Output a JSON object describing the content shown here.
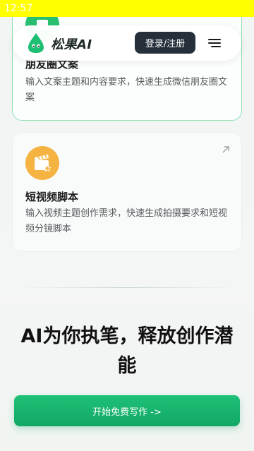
{
  "status_bar": {
    "time": "12:57"
  },
  "header": {
    "brand": "松果AI",
    "login_label": "登录/注册"
  },
  "cards": [
    {
      "title": "朋友圈文案",
      "description": "输入文案主题和内容要求，快速生成微信朋友圈文案",
      "icon": "moments-icon"
    },
    {
      "title": "短视频脚本",
      "description": "输入视频主题创作需求，快速生成拍摄要求和短视频分镜脚本",
      "icon": "clapperboard-icon"
    }
  ],
  "hero": {
    "headline": "AI为你执笔，释放创作潜能",
    "cta_label": "开始免费写作 ->"
  },
  "colors": {
    "status_bar": "#ffff00",
    "accent_green": "#1ec077",
    "login_button": "#26303b",
    "video_icon_bg": "#f5b342"
  }
}
